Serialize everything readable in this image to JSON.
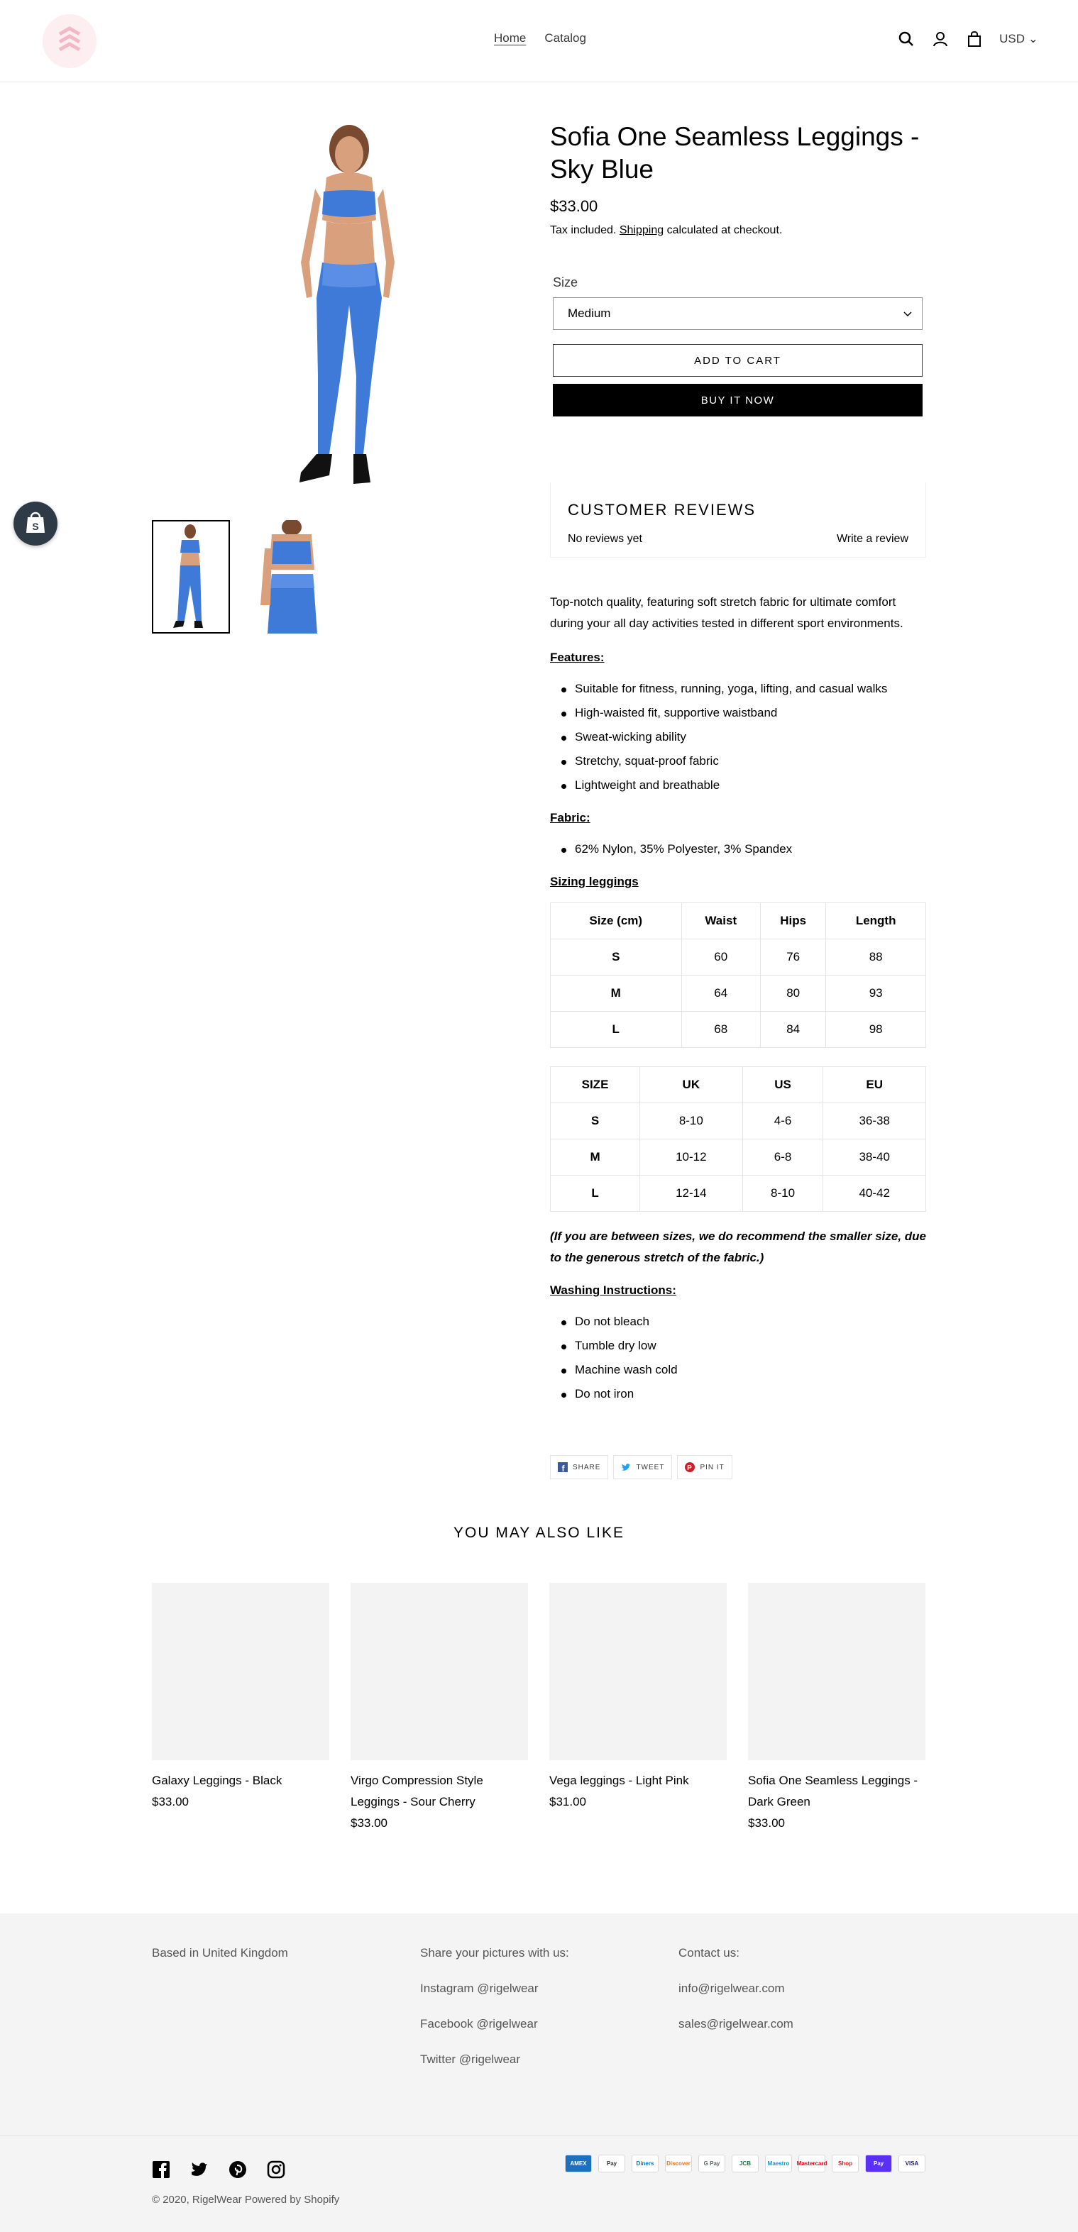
{
  "header": {
    "nav": [
      "Home",
      "Catalog"
    ],
    "currency": "USD"
  },
  "product": {
    "title": "Sofia One Seamless Leggings - Sky Blue",
    "price": "$33.00",
    "tax_prefix": "Tax included.",
    "tax_link": "Shipping",
    "tax_suffix": "calculated at checkout.",
    "size_label": "Size",
    "size_value": "Medium",
    "add_to_cart": "ADD TO CART",
    "buy_now": "BUY IT NOW"
  },
  "reviews": {
    "title": "CUSTOMER REVIEWS",
    "empty": "No reviews yet",
    "write": "Write a review"
  },
  "description": {
    "intro": "Top-notch quality, featuring soft stretch fabric for ultimate comfort during your all day activities tested in different sport environments.",
    "features_heading": "Features:",
    "features": [
      "Suitable for fitness, running, yoga, lifting, and casual walks",
      "High-waisted fit, supportive waistband",
      "Sweat-wicking ability",
      "Stretchy, squat-proof fabric",
      "Lightweight and breathable"
    ],
    "fabric_heading": "Fabric:",
    "fabric": [
      "62% Nylon, 35% Polyester, 3% Spandex"
    ],
    "sizing_heading": "Sizing leggings",
    "size_table_cm": [
      [
        "Size (cm)",
        "Waist",
        "Hips",
        "Length"
      ],
      [
        "S",
        "60",
        "76",
        "88"
      ],
      [
        "M",
        "64",
        "80",
        "93"
      ],
      [
        "L",
        "68",
        "84",
        "98"
      ]
    ],
    "size_table_intl": [
      [
        "SIZE",
        "UK",
        "US",
        "EU"
      ],
      [
        "S",
        "8-10",
        "4-6",
        "36-38"
      ],
      [
        "M",
        "10-12",
        "6-8",
        "38-40"
      ],
      [
        "L",
        "12-14",
        "8-10",
        "40-42"
      ]
    ],
    "note": "(If you are between sizes, we do recommend the smaller size, due to the generous stretch of the fabric.)",
    "washing_heading": "Washing Instructions:",
    "washing": [
      "Do not bleach",
      "Tumble dry low",
      "Machine wash cold",
      "Do not iron"
    ]
  },
  "share": {
    "facebook": "SHARE",
    "twitter": "TWEET",
    "pinterest": "PIN IT"
  },
  "related": {
    "title": "YOU MAY ALSO LIKE",
    "items": [
      {
        "name": "Galaxy Leggings - Black",
        "price": "$33.00"
      },
      {
        "name": "Virgo Compression Style Leggings - Sour Cherry",
        "price": "$33.00"
      },
      {
        "name": "Vega leggings - Light Pink",
        "price": "$31.00"
      },
      {
        "name": "Sofia One Seamless Leggings - Dark Green",
        "price": "$33.00"
      }
    ]
  },
  "footer": {
    "location": "Based in United Kingdom",
    "share_heading": "Share your pictures with us:",
    "socials": [
      "Instagram @rigelwear",
      "Facebook @rigelwear",
      "Twitter @rigelwear"
    ],
    "contact_heading": "Contact us:",
    "emails": [
      "info@rigelwear.com",
      "sales@rigelwear.com"
    ],
    "copyright": "© 2020, RigelWear Powered by Shopify",
    "payment_methods": [
      "AMEX",
      "Pay",
      "Diners",
      "Discover",
      "G Pay",
      "JCB",
      "Maestro",
      "Mastercard",
      "Shop",
      "Pay",
      "VISA"
    ]
  },
  "colors": {
    "legging_blue": "#3f7ad8",
    "button_black": "#000000",
    "footer_bg": "#f4f4f4"
  },
  "icons": [
    "search-icon",
    "account-icon",
    "cart-icon",
    "chevron-down-icon",
    "facebook-icon",
    "twitter-icon",
    "pinterest-icon",
    "instagram-icon",
    "shopify-bag-icon"
  ]
}
